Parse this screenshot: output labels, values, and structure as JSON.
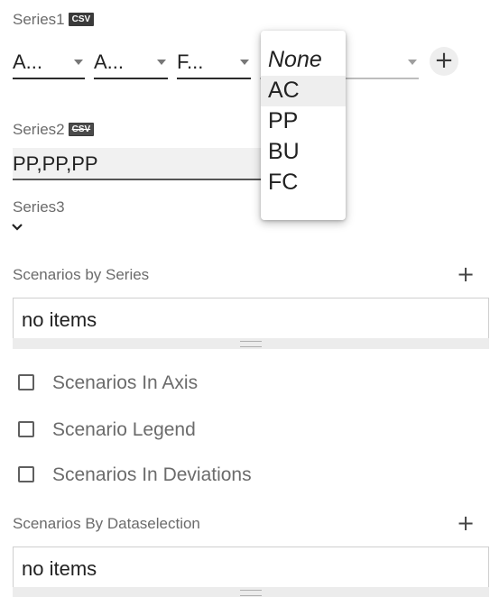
{
  "series1": {
    "label": "Series1",
    "badge": "CSV",
    "selects": [
      "A...",
      "A...",
      "F...",
      ""
    ],
    "add": "+"
  },
  "dropdown": {
    "options": [
      "None",
      "AC",
      "PP",
      "BU",
      "FC"
    ],
    "highlighted": "AC"
  },
  "series2": {
    "label": "Series2",
    "badge": "CSV",
    "value": "PP,PP,PP"
  },
  "series3": {
    "label": "Series3",
    "expand_icon": "chevron-down-icon"
  },
  "scenarios_by_series": {
    "label": "Scenarios by Series",
    "add": "+",
    "empty_text": "no items"
  },
  "options": [
    {
      "label": "Scenarios In Axis",
      "checked": false
    },
    {
      "label": "Scenario Legend",
      "checked": false
    },
    {
      "label": "Scenarios In Deviations",
      "checked": false
    }
  ],
  "scenarios_by_dataselection": {
    "label": "Scenarios By Dataselection",
    "add": "+",
    "empty_text": "no items"
  }
}
